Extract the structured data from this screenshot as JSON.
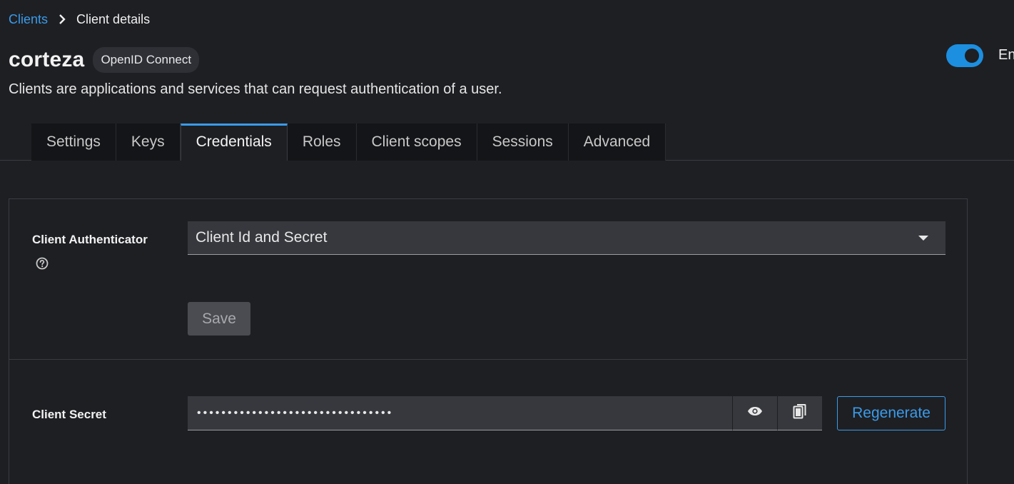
{
  "breadcrumb": {
    "parent": "Clients",
    "current": "Client details"
  },
  "header": {
    "title": "corteza",
    "protocol_badge": "OpenID Connect",
    "subtitle": "Clients are applications and services that can request authentication of a user.",
    "toggle_label": "Enabled",
    "toggle_on": true
  },
  "tabs": [
    {
      "label": "Settings",
      "active": false
    },
    {
      "label": "Keys",
      "active": false
    },
    {
      "label": "Credentials",
      "active": true
    },
    {
      "label": "Roles",
      "active": false
    },
    {
      "label": "Client scopes",
      "active": false
    },
    {
      "label": "Sessions",
      "active": false
    },
    {
      "label": "Advanced",
      "active": false
    }
  ],
  "credentials": {
    "authenticator_label": "Client Authenticator",
    "authenticator_value": "Client Id and Secret",
    "save_label": "Save",
    "secret_label": "Client Secret",
    "secret_value": "••••••••••••••••••••••••••••••••",
    "regenerate_label": "Regenerate"
  },
  "colors": {
    "accent": "#3a9bea",
    "background": "#1e1f23",
    "toggle": "#1c8fe0"
  },
  "icons": {
    "breadcrumb_separator": "chevron-right-icon",
    "help": "help-circle-icon",
    "show_secret": "eye-icon",
    "copy_secret": "copy-icon",
    "dropdown": "caret-down-icon"
  }
}
